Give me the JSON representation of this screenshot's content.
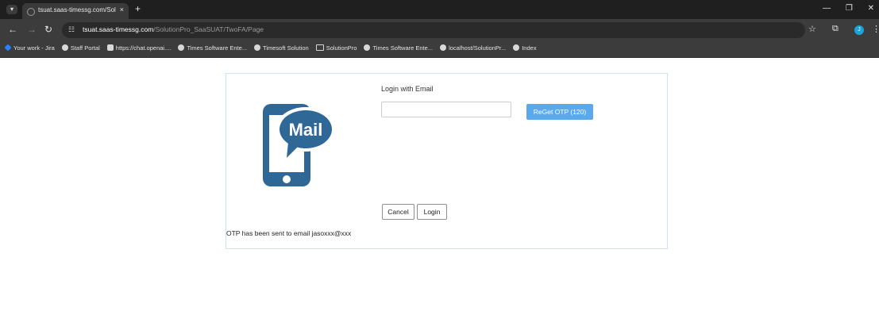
{
  "browser": {
    "tab_title": "tsuat.saas-timessg.com/Solutio",
    "tab_close": "×",
    "new_tab": "+",
    "url_host": "tsuat.saas-timessg.com",
    "url_path": "/SolutionPro_SaaSUAT/TwoFA/Page",
    "profile_initial": "J",
    "bookmarks": [
      {
        "label": "Your work - Jira",
        "icon": "jira-icon"
      },
      {
        "label": "Staff Portal",
        "icon": "globe-icon"
      },
      {
        "label": "https://chat.openai....",
        "icon": "chatgpt-icon"
      },
      {
        "label": "Times Software Ente...",
        "icon": "globe-icon"
      },
      {
        "label": "Timesoft Solution",
        "icon": "globe-icon"
      },
      {
        "label": "SolutionPro",
        "icon": "folder-icon"
      },
      {
        "label": "Times Software Ente...",
        "icon": "globe-icon"
      },
      {
        "label": "localhost/SolutionPr...",
        "icon": "globe-icon"
      },
      {
        "label": "Index",
        "icon": "globe-icon"
      }
    ]
  },
  "login": {
    "heading": "Login with Email",
    "email_value": "",
    "reget_otp_label": "ReGet OTP (120)",
    "cancel_label": "Cancel",
    "login_label": "Login",
    "otp_message": "OTP has been sent to email jasoxxx@xxx",
    "illustration_text": "Mail"
  },
  "colors": {
    "accent_button": "#5aa9ed",
    "mail_icon": "#2f6797",
    "panel_border": "#cfe0ee"
  }
}
